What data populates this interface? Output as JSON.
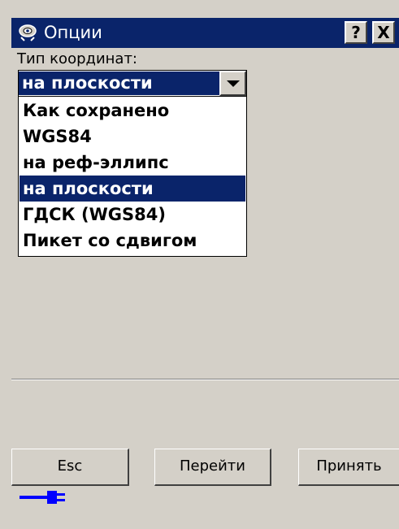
{
  "window": {
    "title": "Опции",
    "help_glyph": "?",
    "close_glyph": "X",
    "icons": {
      "app": "satellite-icon",
      "help": "help-icon",
      "close": "close-icon",
      "status": "plug-icon"
    },
    "colors": {
      "selection": "#0a246a",
      "face": "#d4d0c8",
      "plug": "#0000ff"
    }
  },
  "form": {
    "coord_type_label": "Тип координат:",
    "combo": {
      "selected": "на плоскости",
      "options": [
        "Как сохранено",
        "WGS84",
        "на реф-эллипс",
        "на плоскости",
        "ГДСК (WGS84)",
        "Пикет со сдвигом"
      ]
    }
  },
  "buttons": {
    "esc": "Esc",
    "goto": "Перейти",
    "accept": "Принять"
  }
}
